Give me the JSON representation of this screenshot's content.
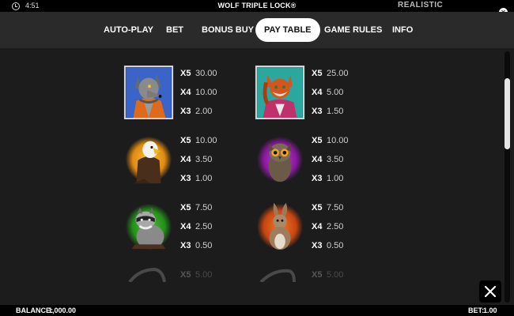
{
  "statusbar": {
    "time": "4:51",
    "title": "WOLF TRIPLE LOCK®",
    "brand": "REALISTIC"
  },
  "nav": {
    "tabs": [
      "AUTO-PLAY",
      "BET",
      "BONUS BUY",
      "PAY TABLE",
      "GAME RULES",
      "INFO"
    ],
    "active": "PAY TABLE"
  },
  "paytable": [
    {
      "symbol": "wolf",
      "pays": [
        {
          "mult": "X5",
          "value": "30.00"
        },
        {
          "mult": "X4",
          "value": "10.00"
        },
        {
          "mult": "X3",
          "value": "2.00"
        }
      ]
    },
    {
      "symbol": "fox",
      "pays": [
        {
          "mult": "X5",
          "value": "25.00"
        },
        {
          "mult": "X4",
          "value": "5.00"
        },
        {
          "mult": "X3",
          "value": "1.50"
        }
      ]
    },
    {
      "symbol": "eagle",
      "pays": [
        {
          "mult": "X5",
          "value": "10.00"
        },
        {
          "mult": "X4",
          "value": "3.50"
        },
        {
          "mult": "X3",
          "value": "1.00"
        }
      ]
    },
    {
      "symbol": "owl",
      "pays": [
        {
          "mult": "X5",
          "value": "10.00"
        },
        {
          "mult": "X4",
          "value": "3.50"
        },
        {
          "mult": "X3",
          "value": "1.00"
        }
      ]
    },
    {
      "symbol": "raccoon",
      "pays": [
        {
          "mult": "X5",
          "value": "7.50"
        },
        {
          "mult": "X4",
          "value": "2.50"
        },
        {
          "mult": "X3",
          "value": "0.50"
        }
      ]
    },
    {
      "symbol": "hare",
      "pays": [
        {
          "mult": "X5",
          "value": "7.50"
        },
        {
          "mult": "X4",
          "value": "2.50"
        },
        {
          "mult": "X3",
          "value": "0.50"
        }
      ]
    },
    {
      "symbol": "partial-symbol-left",
      "pays": [
        {
          "mult": "X5",
          "value": "5.00"
        }
      ]
    },
    {
      "symbol": "partial-symbol-right",
      "pays": [
        {
          "mult": "X5",
          "value": "5.00"
        }
      ]
    }
  ],
  "footer": {
    "balance_label": "BALANCE:",
    "balance_value": "1,000.00",
    "bet_label": "BET:",
    "bet_value": "1.00"
  },
  "colors": {
    "nav_bg": "#2a2a2a",
    "content_bg": "#1c1c1c",
    "eagle_glow": "#e8a21a",
    "owl_glow": "#9b1fb0",
    "raccoon_glow": "#2fa82a",
    "hare_glow": "#e0561a"
  }
}
